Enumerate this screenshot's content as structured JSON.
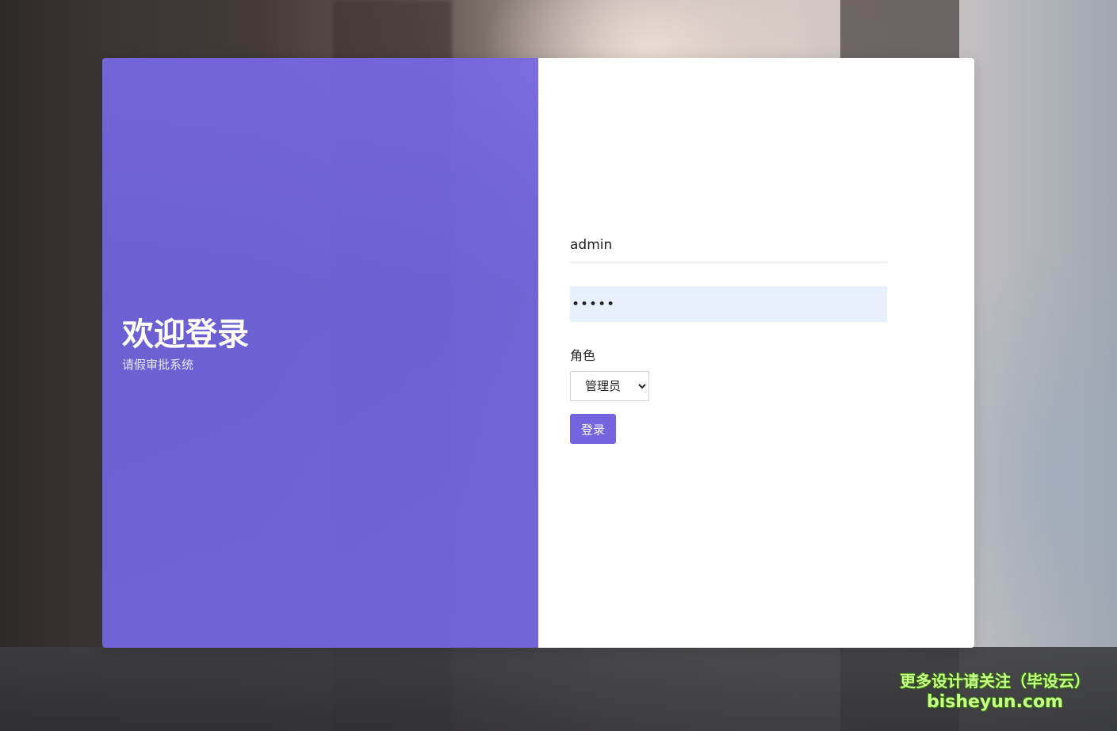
{
  "welcome": {
    "title": "欢迎登录",
    "subtitle": "请假审批系统"
  },
  "login_form": {
    "username_value": "admin",
    "password_value": "•••••",
    "role_label": "角色",
    "role_options": [
      "管理员"
    ],
    "role_selected": "管理员",
    "submit_label": "登录"
  },
  "watermark": {
    "line1": "更多设计请关注（毕设云）",
    "line2": "bisheyun.com"
  },
  "colors": {
    "left_panel": "#7264DC",
    "login_button": "#7563E0",
    "password_bg": "#E8F0FE",
    "watermark_text": "#C8FF8C"
  }
}
